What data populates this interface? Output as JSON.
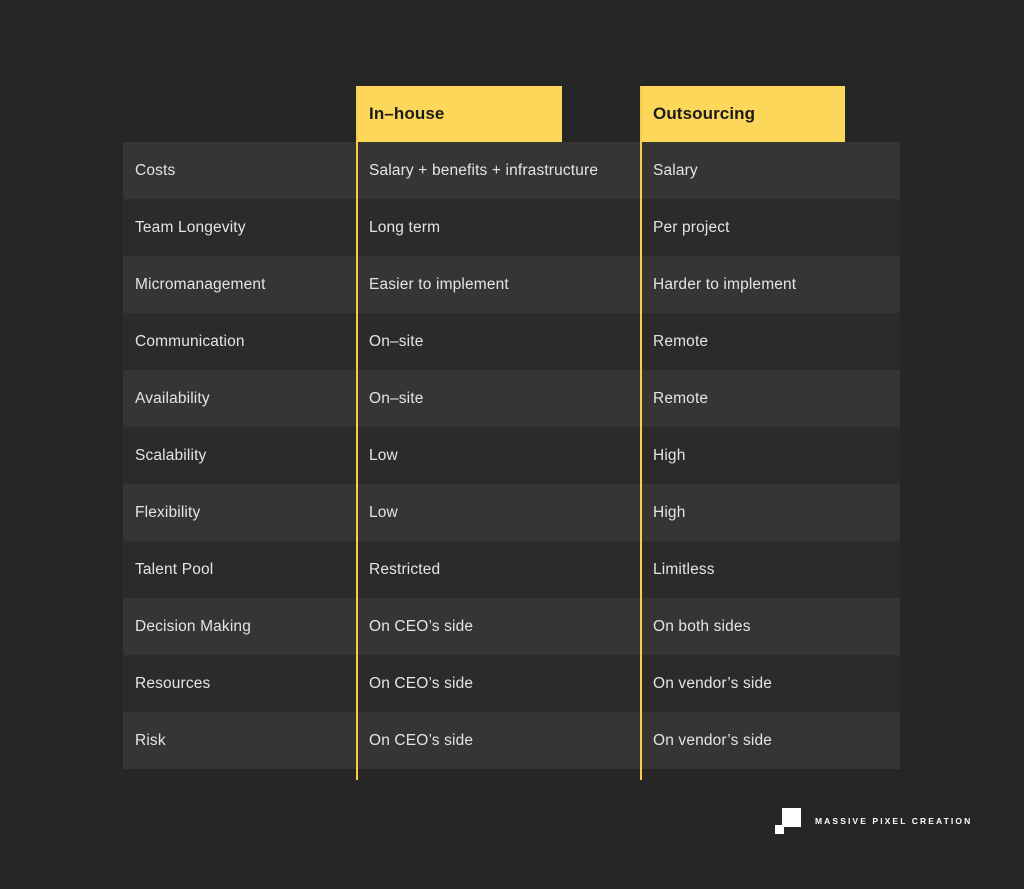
{
  "table": {
    "headers": {
      "label_column": "",
      "col1": "In–house",
      "col2": "Outsourcing"
    },
    "rows": [
      {
        "label": "Costs",
        "inhouse": "Salary + benefits + infrastructure",
        "outsourcing": "Salary"
      },
      {
        "label": "Team Longevity",
        "inhouse": "Long term",
        "outsourcing": "Per project"
      },
      {
        "label": "Micromanagement",
        "inhouse": "Easier to implement",
        "outsourcing": "Harder to implement"
      },
      {
        "label": "Communication",
        "inhouse": "On–site",
        "outsourcing": "Remote"
      },
      {
        "label": "Availability",
        "inhouse": "On–site",
        "outsourcing": "Remote"
      },
      {
        "label": "Scalability",
        "inhouse": "Low",
        "outsourcing": "High"
      },
      {
        "label": "Flexibility",
        "inhouse": "Low",
        "outsourcing": "High"
      },
      {
        "label": "Talent Pool",
        "inhouse": "Restricted",
        "outsourcing": "Limitless"
      },
      {
        "label": "Decision Making",
        "inhouse": "On CEO’s side",
        "outsourcing": "On both sides"
      },
      {
        "label": "Resources",
        "inhouse": "On CEO’s side",
        "outsourcing": "On vendor’s side"
      },
      {
        "label": "Risk",
        "inhouse": "On CEO’s side",
        "outsourcing": "On vendor’s side"
      }
    ]
  },
  "logo": {
    "text": "MASSIVE PIXEL CREATION",
    "mark": "two-squares-icon"
  },
  "colors": {
    "background": "#262626",
    "accent_yellow": "#FCD75A",
    "divider_yellow": "#F5CE4E",
    "row_light": "#353535",
    "row_dark": "#2B2B2B",
    "text": "#E4E4E4",
    "header_text": "#1B1B1B"
  }
}
